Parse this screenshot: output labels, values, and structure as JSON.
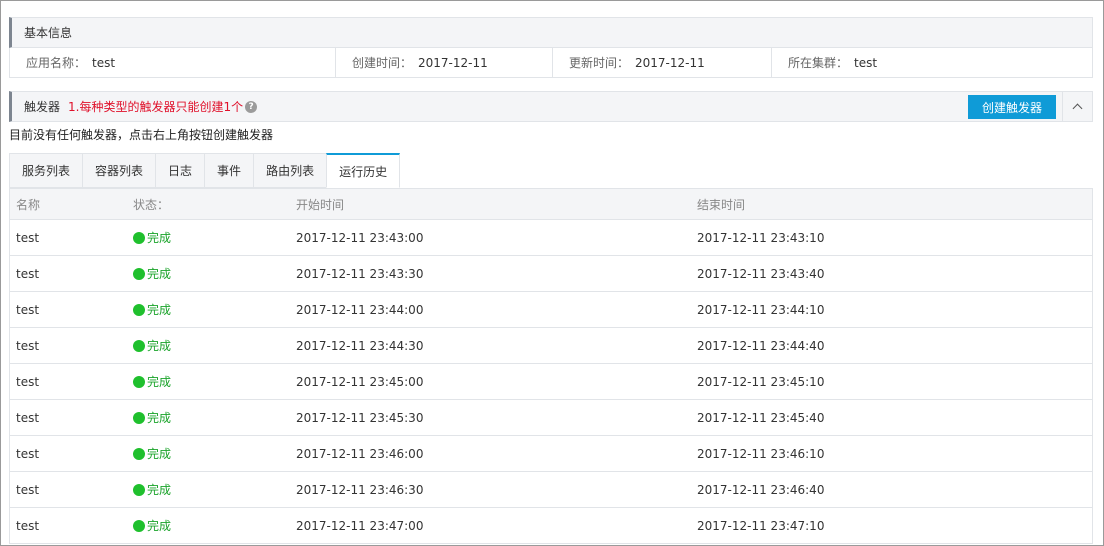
{
  "basic_info": {
    "title": "基本信息",
    "fields": [
      {
        "label": "应用名称：",
        "value": "test"
      },
      {
        "label": "创建时间：",
        "value": "2017-12-11"
      },
      {
        "label": "更新时间：",
        "value": "2017-12-11"
      },
      {
        "label": "所在集群：",
        "value": "test"
      }
    ]
  },
  "trigger": {
    "title": "触发器",
    "warning": "1.每种类型的触发器只能创建1个",
    "help_icon": "question-circle-icon",
    "create_button": "创建触发器",
    "collapse_icon": "chevron-up-icon",
    "empty_message": "目前没有任何触发器，点击右上角按钮创建触发器"
  },
  "tabs": [
    {
      "label": "服务列表",
      "active": false
    },
    {
      "label": "容器列表",
      "active": false
    },
    {
      "label": "日志",
      "active": false
    },
    {
      "label": "事件",
      "active": false
    },
    {
      "label": "路由列表",
      "active": false
    },
    {
      "label": "运行历史",
      "active": true
    }
  ],
  "table": {
    "columns": [
      "名称",
      "状态：",
      "开始时间",
      "结束时间"
    ],
    "rows": [
      {
        "name": "test",
        "status": "完成",
        "start": "2017-12-11 23:43:00",
        "end": "2017-12-11 23:43:10"
      },
      {
        "name": "test",
        "status": "完成",
        "start": "2017-12-11 23:43:30",
        "end": "2017-12-11 23:43:40"
      },
      {
        "name": "test",
        "status": "完成",
        "start": "2017-12-11 23:44:00",
        "end": "2017-12-11 23:44:10"
      },
      {
        "name": "test",
        "status": "完成",
        "start": "2017-12-11 23:44:30",
        "end": "2017-12-11 23:44:40"
      },
      {
        "name": "test",
        "status": "完成",
        "start": "2017-12-11 23:45:00",
        "end": "2017-12-11 23:45:10"
      },
      {
        "name": "test",
        "status": "完成",
        "start": "2017-12-11 23:45:30",
        "end": "2017-12-11 23:45:40"
      },
      {
        "name": "test",
        "status": "完成",
        "start": "2017-12-11 23:46:00",
        "end": "2017-12-11 23:46:10"
      },
      {
        "name": "test",
        "status": "完成",
        "start": "2017-12-11 23:46:30",
        "end": "2017-12-11 23:46:40"
      },
      {
        "name": "test",
        "status": "完成",
        "start": "2017-12-11 23:47:00",
        "end": "2017-12-11 23:47:10"
      }
    ]
  },
  "colors": {
    "accent": "#0f9bd7",
    "success": "#1fc02d",
    "warning": "#e0112b"
  }
}
